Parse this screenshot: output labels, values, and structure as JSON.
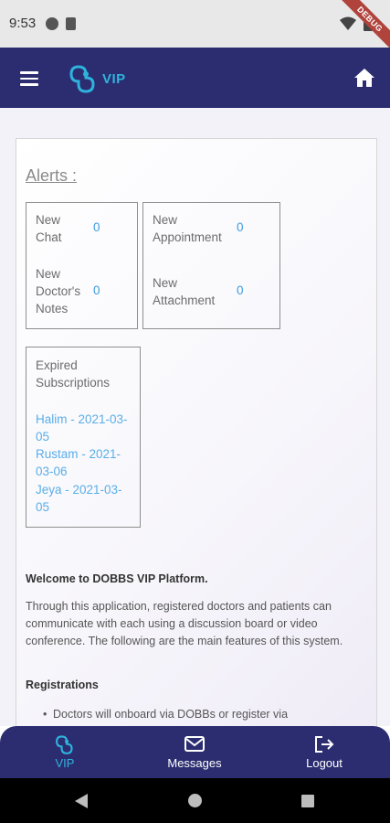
{
  "status_bar": {
    "time": "9:53",
    "debug_banner": "DEBUG"
  },
  "app_bar": {
    "logo_text": "VIP",
    "brand_color": "#2b2d70",
    "accent_color": "#2fb3dd"
  },
  "alerts": {
    "title": "Alerts :",
    "new_chat_label": "New\nChat",
    "new_chat_count": "0",
    "new_appointment_label": "New\nAppointment",
    "new_appointment_count": "0",
    "new_notes_label": "New\nDoctor's\nNotes",
    "new_notes_count": "0",
    "new_attachment_label": "New\nAttachment",
    "new_attachment_count": "0",
    "expired_label": "Expired\nSubscriptions",
    "expired_items": [
      "Halim - 2021-03-\n05",
      "Rustam - 2021-\n03-06",
      "Jeya - 2021-03-\n05"
    ]
  },
  "welcome": {
    "title": "Welcome to DOBBS VIP Platform.",
    "text": "Through this application, registered doctors and patients  can communicate with each using a discussion board or  video conference.  The following are the main features of this system.",
    "registrations_title": "Registrations",
    "registrations_item": "Doctors will onboard via DOBBs or register via"
  },
  "bottom_nav": {
    "vip_label": "VIP",
    "messages_label": "Messages",
    "logout_label": "Logout"
  }
}
